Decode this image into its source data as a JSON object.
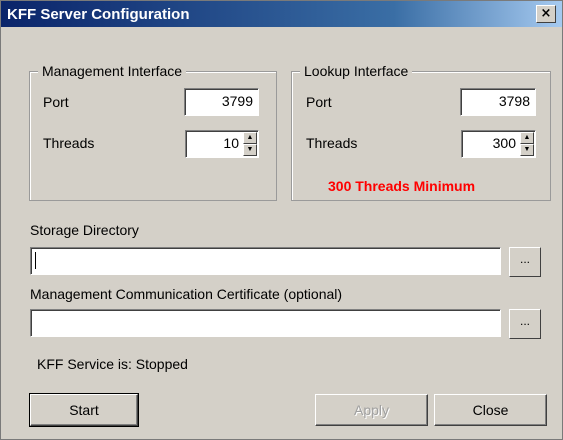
{
  "window": {
    "title": "KFF Server Configuration",
    "close_glyph": "×"
  },
  "management": {
    "legend": "Management Interface",
    "port_label": "Port",
    "port_value": "3799",
    "threads_label": "Threads",
    "threads_value": "10"
  },
  "lookup": {
    "legend": "Lookup Interface",
    "port_label": "Port",
    "port_value": "3798",
    "threads_label": "Threads",
    "threads_value": "300",
    "warning": "300 Threads Minimum",
    "warning_color": "#ff0000"
  },
  "storage": {
    "label": "Storage Directory",
    "value": "",
    "browse_label": "..."
  },
  "certificate": {
    "label": "Management Communication Certificate (optional)",
    "value": "",
    "browse_label": "..."
  },
  "status": {
    "text": "KFF Service is: Stopped"
  },
  "buttons": {
    "start": "Start",
    "apply": "Apply",
    "close": "Close"
  }
}
